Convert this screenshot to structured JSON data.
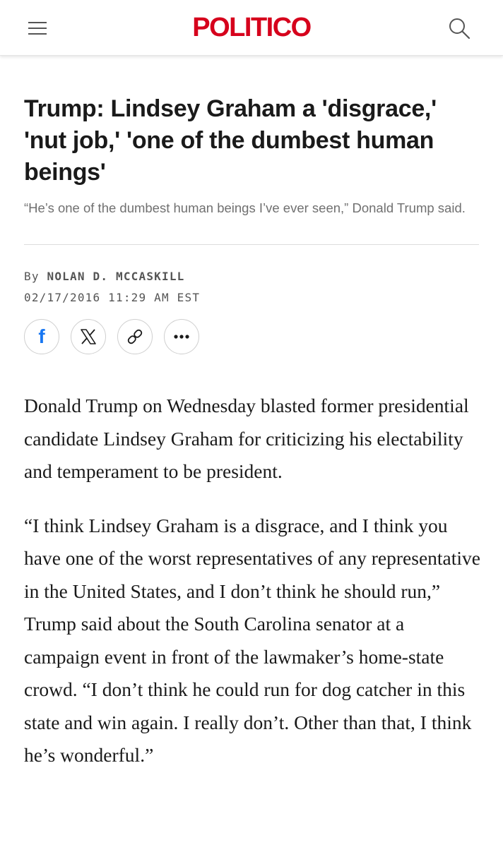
{
  "header": {
    "logo_text": "POLITICO",
    "brand_color": "#d6001c",
    "menu_icon": "hamburger-menu-icon",
    "search_icon": "search-icon"
  },
  "article": {
    "headline": "Trump: Lindsey Graham a 'disgrace,' 'nut job,' 'one of the dumbest human beings'",
    "subhead": "“He’s one of the dumbest human beings I’ve ever seen,” Donald Trump said.",
    "byline_prefix": "By",
    "author": "NOLAN D. MCCASKILL",
    "dateline": "02/17/2016 11:29 AM EST",
    "share_buttons": [
      {
        "name": "facebook",
        "icon": "facebook-icon"
      },
      {
        "name": "x",
        "icon": "x-icon"
      },
      {
        "name": "copy-link",
        "icon": "link-icon"
      },
      {
        "name": "more",
        "icon": "more-icon"
      }
    ],
    "paragraphs": [
      "Donald Trump on Wednesday blasted former presidential candidate Lindsey Graham for criticizing his electability and temperament to be president.",
      "“I think Lindsey Graham is a disgrace, and I think you have one of the worst representatives of any representative in the United States, and I don’t think he should run,” Trump said about the South Carolina senator at a campaign event in front of the lawmaker’s home-state crowd. “I don’t think he could run for dog catcher in this state and win again. I really don’t. Other than that, I think he’s wonderful.”"
    ]
  }
}
